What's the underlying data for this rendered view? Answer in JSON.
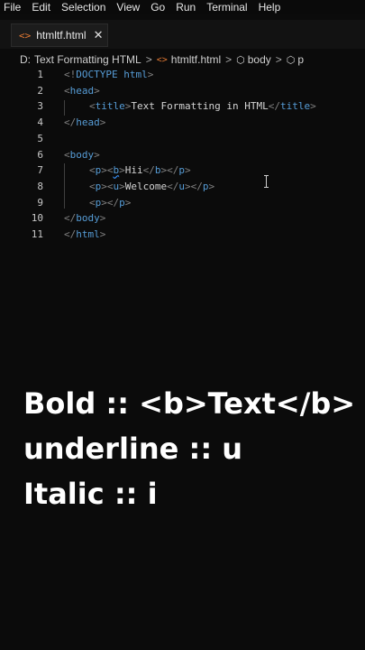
{
  "menu": [
    "File",
    "Edit",
    "Selection",
    "View",
    "Go",
    "Run",
    "Terminal",
    "Help"
  ],
  "tab": {
    "icon": "<>",
    "label": "htmltf.html",
    "close": "✕"
  },
  "breadcrumb": {
    "drive": "D:",
    "folder": "Text Formatting HTML",
    "file": "htmltf.html",
    "body": "body",
    "p": "p",
    "separator": ">"
  },
  "editor": {
    "lines": [
      {
        "num": "1",
        "text": "<!DOCTYPE html>"
      },
      {
        "num": "2",
        "text": "<head>"
      },
      {
        "num": "3",
        "text": "<title>Text Formatting in HTML</title>"
      },
      {
        "num": "4",
        "text": "</head>"
      },
      {
        "num": "5",
        "text": ""
      },
      {
        "num": "6",
        "text": "<body>"
      },
      {
        "num": "7",
        "text": "<p><b>Hii</b></p>"
      },
      {
        "num": "8",
        "text": "<p><u>Welcome</u></p>"
      },
      {
        "num": "9",
        "text": "<p></p>"
      },
      {
        "num": "10",
        "text": "</body>"
      },
      {
        "num": "11",
        "text": "</html>"
      }
    ]
  },
  "overlay": {
    "line1": "Bold :: <b>Text</b>",
    "line2": "underline :: u",
    "line3": "Italic :: i"
  },
  "colors": {
    "tag_bracket": "#808080",
    "tag_name": "#569cd6",
    "text": "#d4d4d4",
    "html_icon": "#e37933"
  }
}
